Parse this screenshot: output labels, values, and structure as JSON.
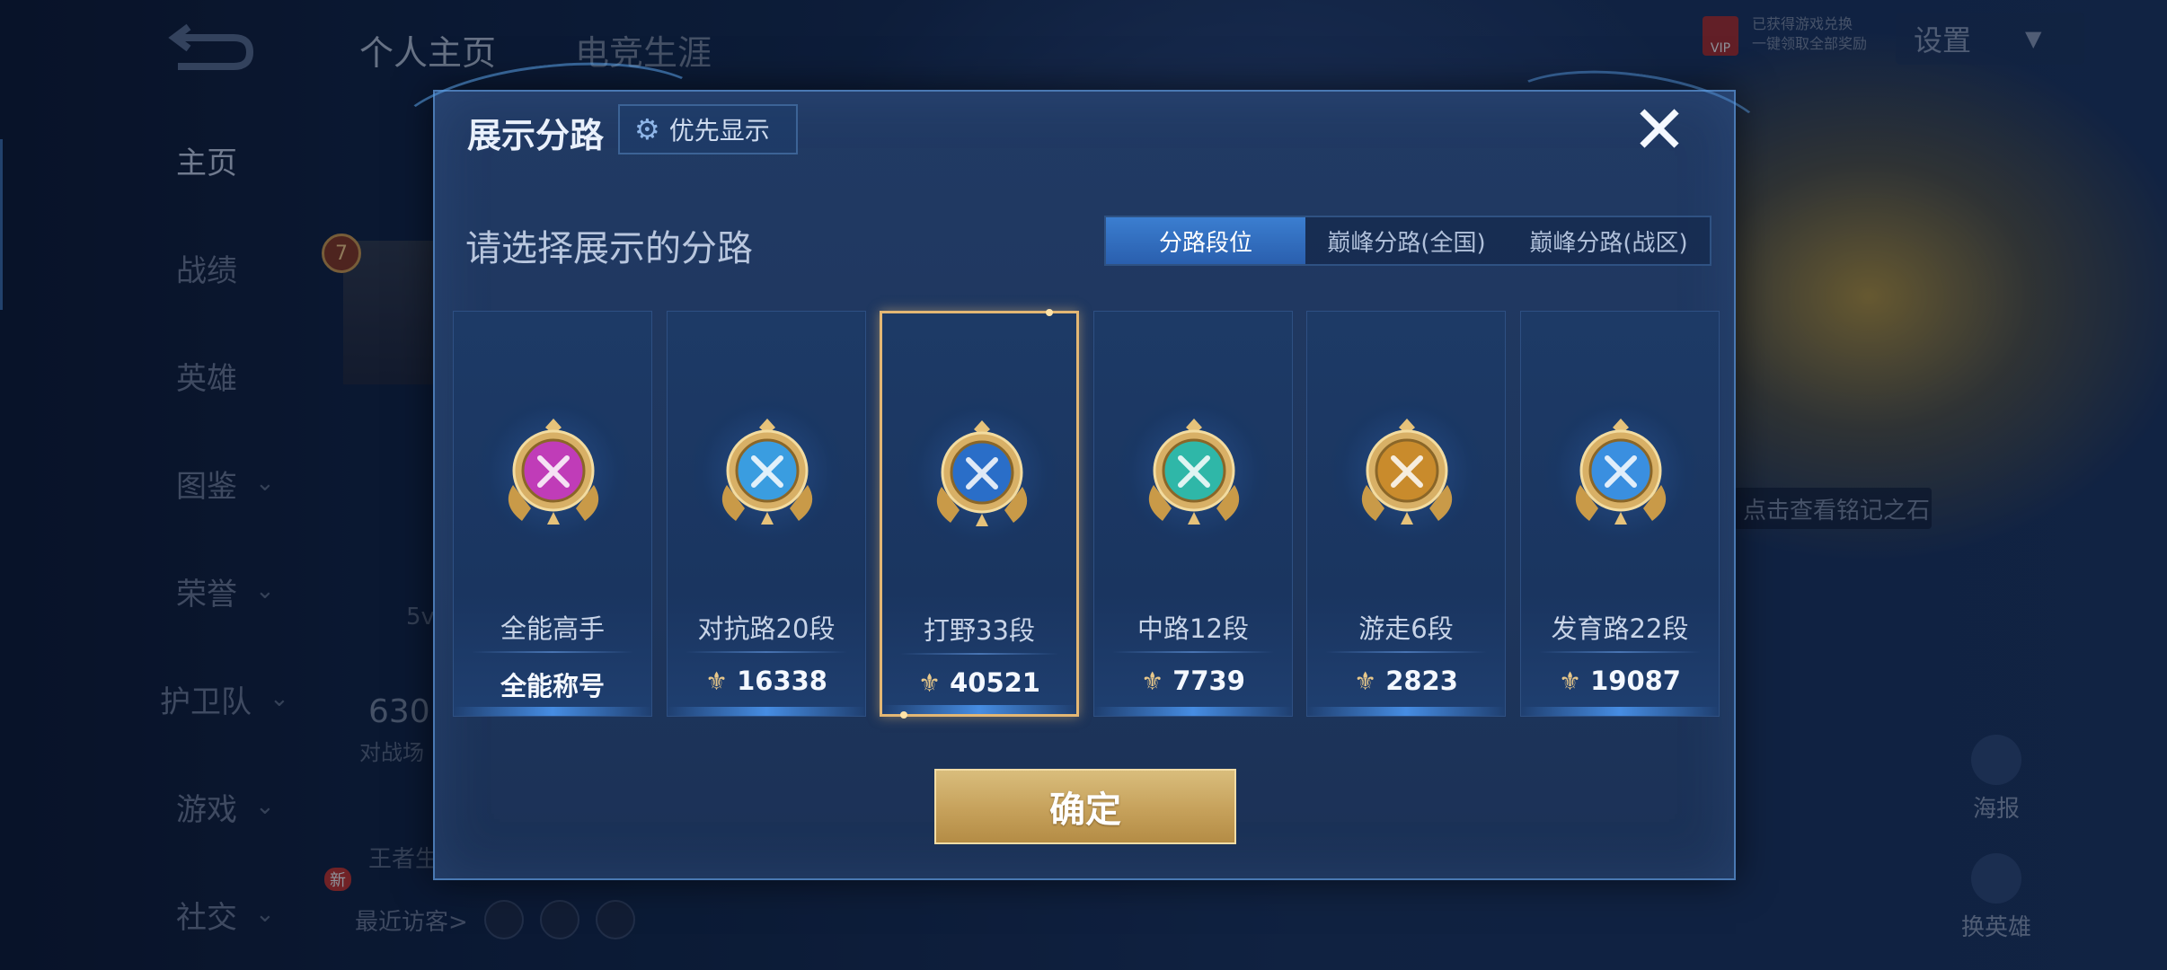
{
  "top_tabs": [
    "个人主页",
    "电竞生涯"
  ],
  "settings_label": "设置",
  "vip": {
    "badge": "VIP",
    "line1": "已获得游戏兑换",
    "line2": "一键领取全部奖励"
  },
  "nav": [
    {
      "label": "主页",
      "active": true
    },
    {
      "label": "战绩"
    },
    {
      "label": "英雄"
    },
    {
      "label": "图鉴",
      "chevron": "⌄"
    },
    {
      "label": "荣誉",
      "chevron": "⌄"
    },
    {
      "label": "护卫队",
      "chevron": "⌄"
    },
    {
      "label": "游戏",
      "chevron": "⌄"
    },
    {
      "label": "社交",
      "chevron": "⌄",
      "badge": "新"
    }
  ],
  "profile": {
    "level": "7",
    "stat_number": "630",
    "stat_label": "对战场",
    "mode": "5v",
    "side_label": "王者生"
  },
  "visitors_label": "最近访客>",
  "right": {
    "hint": "点击查看铭记之石",
    "poster": "海报",
    "switch_hero": "换英雄"
  },
  "dialog": {
    "title": "展示分路",
    "priority_label": "优先显示",
    "close_symbol": "✕",
    "subtitle": "请选择展示的分路",
    "tabs": [
      {
        "label": "分路段位",
        "active": true
      },
      {
        "label": "巅峰分路(全国)"
      },
      {
        "label": "巅峰分路(战区)"
      }
    ],
    "cards": [
      {
        "name": "全能高手",
        "value": "全能称号",
        "icon": "all-round-medal-icon",
        "color": "#c03cb8",
        "selected": false
      },
      {
        "name": "对抗路20段",
        "value": "16338",
        "icon": "clash-lane-medal-icon",
        "color": "#3a9de0",
        "selected": false
      },
      {
        "name": "打野33段",
        "value": "40521",
        "icon": "jungle-medal-icon",
        "color": "#2a6ec8",
        "selected": true
      },
      {
        "name": "中路12段",
        "value": "7739",
        "icon": "mid-lane-medal-icon",
        "color": "#2fb7a8",
        "selected": false
      },
      {
        "name": "游走6段",
        "value": "2823",
        "icon": "roam-medal-icon",
        "color": "#c98b2c",
        "selected": false
      },
      {
        "name": "发育路22段",
        "value": "19087",
        "icon": "farm-lane-medal-icon",
        "color": "#3a8fe0",
        "selected": false
      }
    ],
    "confirm_label": "确定"
  }
}
